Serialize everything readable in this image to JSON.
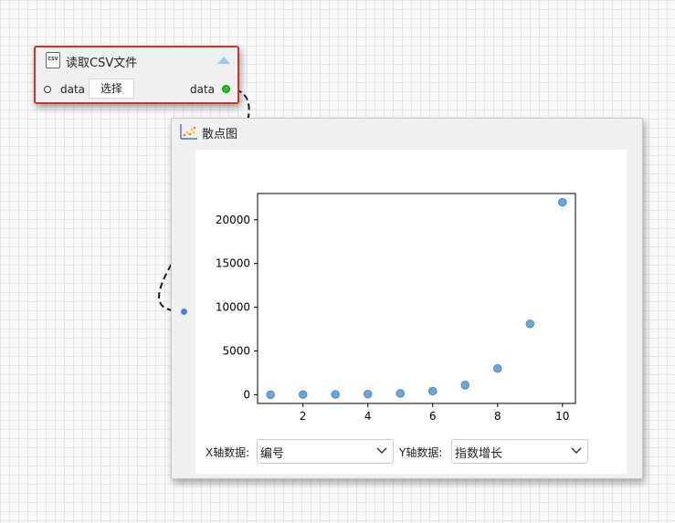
{
  "csv_node": {
    "title": "读取CSV文件",
    "file_icon_text": "CSV",
    "input_port_label": "data",
    "select_button": "选择",
    "output_port_label": "data",
    "border_color": "#c0392b"
  },
  "scatter_node": {
    "title": "散点图",
    "x_axis_label": "X轴数据:",
    "x_axis_value": "编号",
    "y_axis_label": "Y轴数据:",
    "y_axis_value": "指数增长"
  },
  "colors": {
    "point_color": "#5b9bd5",
    "output_port": "#1ec81e",
    "input_port": "#4a7fd6"
  },
  "chart_data": {
    "type": "scatter",
    "x": [
      1,
      2,
      3,
      4,
      5,
      6,
      7,
      8,
      9,
      10
    ],
    "y": [
      0,
      20,
      40,
      60,
      150,
      400,
      1100,
      3000,
      8100,
      22000
    ],
    "xlim": [
      0.6,
      10.4
    ],
    "ylim": [
      -1000,
      23000
    ],
    "x_ticks": [
      2,
      4,
      6,
      8,
      10
    ],
    "y_ticks": [
      0,
      5000,
      10000,
      15000,
      20000
    ],
    "grid": false,
    "title": "",
    "xlabel": "",
    "ylabel": ""
  }
}
